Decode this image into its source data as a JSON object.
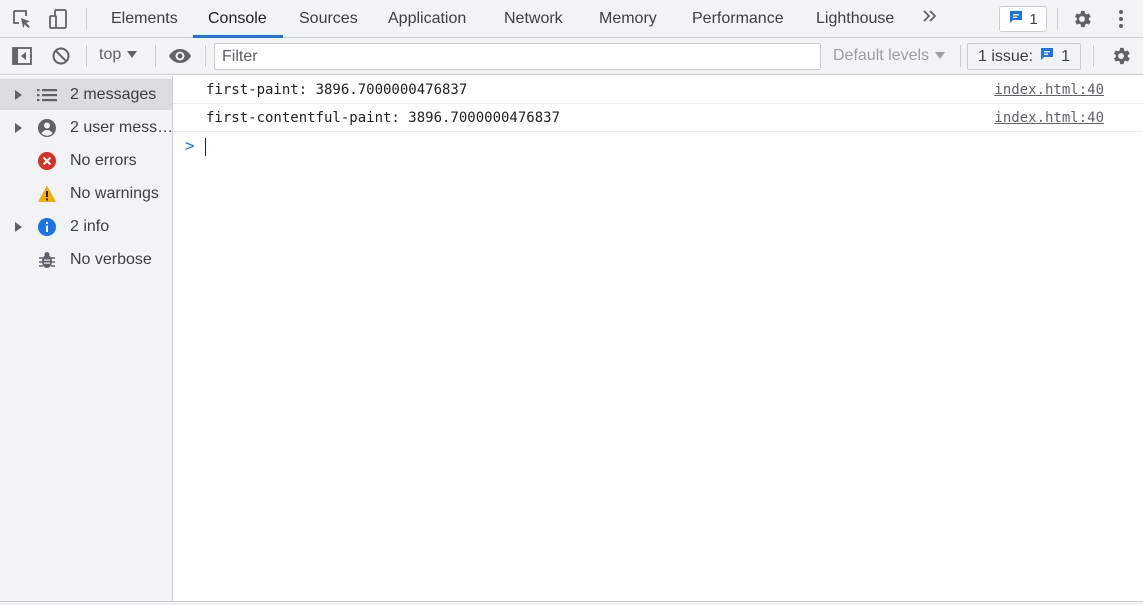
{
  "tabs": [
    {
      "label": "Elements"
    },
    {
      "label": "Console"
    },
    {
      "label": "Sources"
    },
    {
      "label": "Application"
    },
    {
      "label": "Network"
    },
    {
      "label": "Memory"
    },
    {
      "label": "Performance"
    },
    {
      "label": "Lighthouse"
    }
  ],
  "active_tab": "Console",
  "issue_badge_count": "1",
  "toolbar": {
    "context": "top",
    "filter_placeholder": "Filter",
    "levels": "Default levels",
    "issues_label": "1 issue:",
    "issues_count": "1"
  },
  "sidebar": {
    "items": [
      {
        "label": "2 messages",
        "icon": "list-icon",
        "expandable": true,
        "selected": true
      },
      {
        "label": "2 user mess…",
        "icon": "user-icon",
        "expandable": true,
        "selected": false
      },
      {
        "label": "No errors",
        "icon": "error-icon",
        "expandable": false,
        "selected": false
      },
      {
        "label": "No warnings",
        "icon": "warning-icon",
        "expandable": false,
        "selected": false
      },
      {
        "label": "2 info",
        "icon": "info-icon",
        "expandable": true,
        "selected": false
      },
      {
        "label": "No verbose",
        "icon": "bug-icon",
        "expandable": false,
        "selected": false
      }
    ]
  },
  "messages": [
    {
      "text": "first-paint: 3896.7000000476837",
      "source": "index.html:40"
    },
    {
      "text": "first-contentful-paint: 3896.7000000476837",
      "source": "index.html:40"
    }
  ],
  "colors": {
    "accent": "#1a73e8",
    "error": "#d93025",
    "warning": "#f9ab00",
    "toolbar_bg": "#f1f3f4"
  }
}
